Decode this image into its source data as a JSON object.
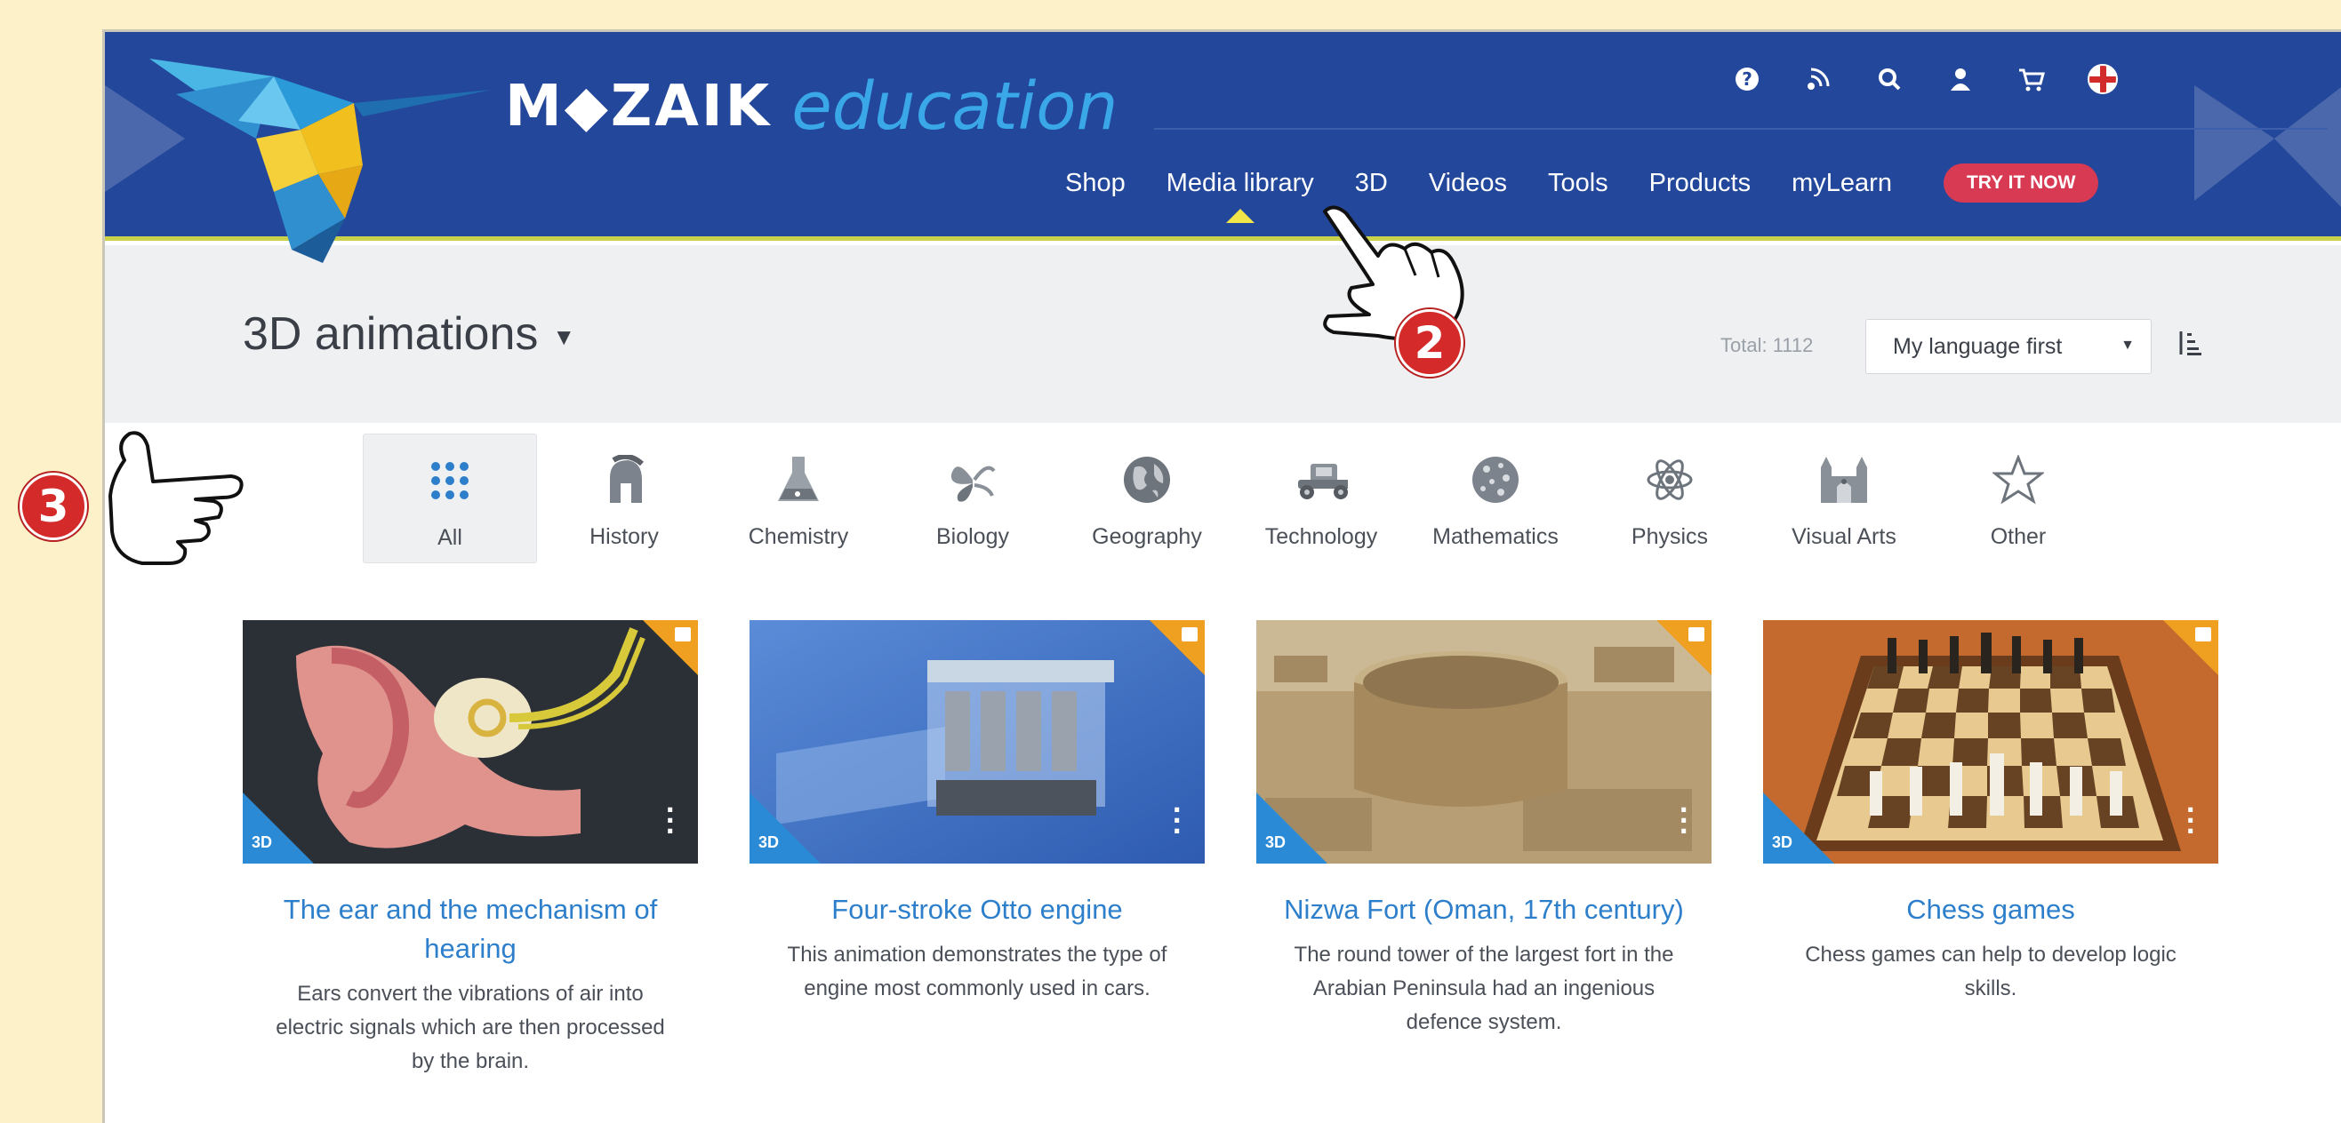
{
  "brand": {
    "name_bold": "M◆ZAIK",
    "name_italic": "education"
  },
  "utility_icons": [
    {
      "name": "help-icon",
      "glyph": "?"
    },
    {
      "name": "share-icon",
      "glyph": "☍"
    },
    {
      "name": "search-icon",
      "glyph": "⌕"
    },
    {
      "name": "user-icon",
      "glyph": "●"
    },
    {
      "name": "cart-icon",
      "glyph": "🛒"
    },
    {
      "name": "language-flag-icon",
      "glyph": ""
    }
  ],
  "nav": {
    "items": [
      "Shop",
      "Media library",
      "3D",
      "Videos",
      "Tools",
      "Products",
      "myLearn"
    ],
    "active": "Media library",
    "try_button": "TRY IT NOW"
  },
  "titlebar": {
    "title": "3D animations",
    "total": "Total: 1112",
    "sort_value": "My language first"
  },
  "categories": [
    {
      "label": "All",
      "icon": "grid-icon",
      "active": true
    },
    {
      "label": "History",
      "icon": "helmet-icon"
    },
    {
      "label": "Chemistry",
      "icon": "flask-icon"
    },
    {
      "label": "Biology",
      "icon": "butterfly-icon"
    },
    {
      "label": "Geography",
      "icon": "globe-icon"
    },
    {
      "label": "Technology",
      "icon": "car-icon"
    },
    {
      "label": "Mathematics",
      "icon": "math-ball-icon"
    },
    {
      "label": "Physics",
      "icon": "atom-icon"
    },
    {
      "label": "Visual Arts",
      "icon": "cathedral-icon"
    },
    {
      "label": "Other",
      "icon": "star-icon"
    }
  ],
  "cards": [
    {
      "badge": "3D",
      "title": "The ear and the mechanism of hearing",
      "description": "Ears convert the vibrations of air into electric signals which are then processed by the brain."
    },
    {
      "badge": "3D",
      "title": "Four-stroke Otto engine",
      "description": "This animation demonstrates the type of engine most commonly used in cars."
    },
    {
      "badge": "3D",
      "title": "Nizwa Fort (Oman, 17th century)",
      "description": "The round tower of the largest fort in the Arabian Peninsula had an ingenious defence system."
    },
    {
      "badge": "3D",
      "title": "Chess games",
      "description": "Chess games can help to develop logic skills."
    }
  ],
  "annotations": {
    "step_2": "2",
    "step_3": "3"
  },
  "colors": {
    "header": "#23479a",
    "accent_blue": "#2d7fcb",
    "try_button": "#d73a52",
    "corner_orange": "#f0a020",
    "corner_blue": "#2a8ad6",
    "page_bg": "#fdf1c9"
  }
}
